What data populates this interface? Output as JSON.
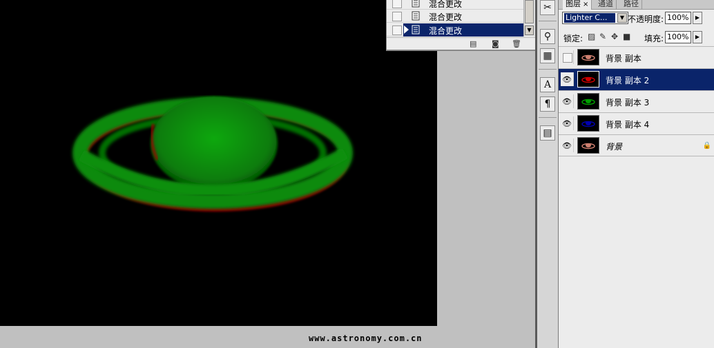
{
  "canvas": {
    "watermark": "www.astronomy.com.cn",
    "background_color": "#000000",
    "ring_color": "#0a8f0a",
    "offset_color": "#a80000"
  },
  "history": {
    "items": [
      {
        "label": "混合更改",
        "selected": false
      },
      {
        "label": "混合更改",
        "selected": false
      },
      {
        "label": "混合更改",
        "selected": true
      }
    ],
    "footer_icons": [
      "new-document-icon",
      "camera-icon",
      "trash-icon"
    ]
  },
  "toolstrip": {
    "icons": [
      "brush-icon",
      "stamp-icon",
      "tool-preset-icon",
      "character-icon",
      "paragraph-icon",
      "layer-comps-icon"
    ]
  },
  "layers_panel": {
    "tabs": [
      {
        "label": "图层",
        "active": true,
        "close": "×"
      },
      {
        "label": "通道",
        "active": false
      },
      {
        "label": "路径",
        "active": false
      }
    ],
    "blend_mode": "Lighter C...",
    "opacity_label": "不透明度:",
    "opacity_value": "100%",
    "lock_label": "锁定:",
    "fill_label": "填充:",
    "fill_value": "100%",
    "layers": [
      {
        "name": "背景 副本",
        "visible": false,
        "selected": false,
        "thumb_color": "#d08070"
      },
      {
        "name": "背景 副本 2",
        "visible": true,
        "selected": true,
        "thumb_color": "#d00000"
      },
      {
        "name": "背景 副本 3",
        "visible": true,
        "selected": false,
        "thumb_color": "#00a000"
      },
      {
        "name": "背景 副本 4",
        "visible": true,
        "selected": false,
        "thumb_color": "#0000b0"
      },
      {
        "name": "背景",
        "visible": true,
        "selected": false,
        "locked": true,
        "thumb_color": "#d08070"
      }
    ]
  },
  "colors": {
    "selection": "#0a246a",
    "panel": "#ececec"
  }
}
